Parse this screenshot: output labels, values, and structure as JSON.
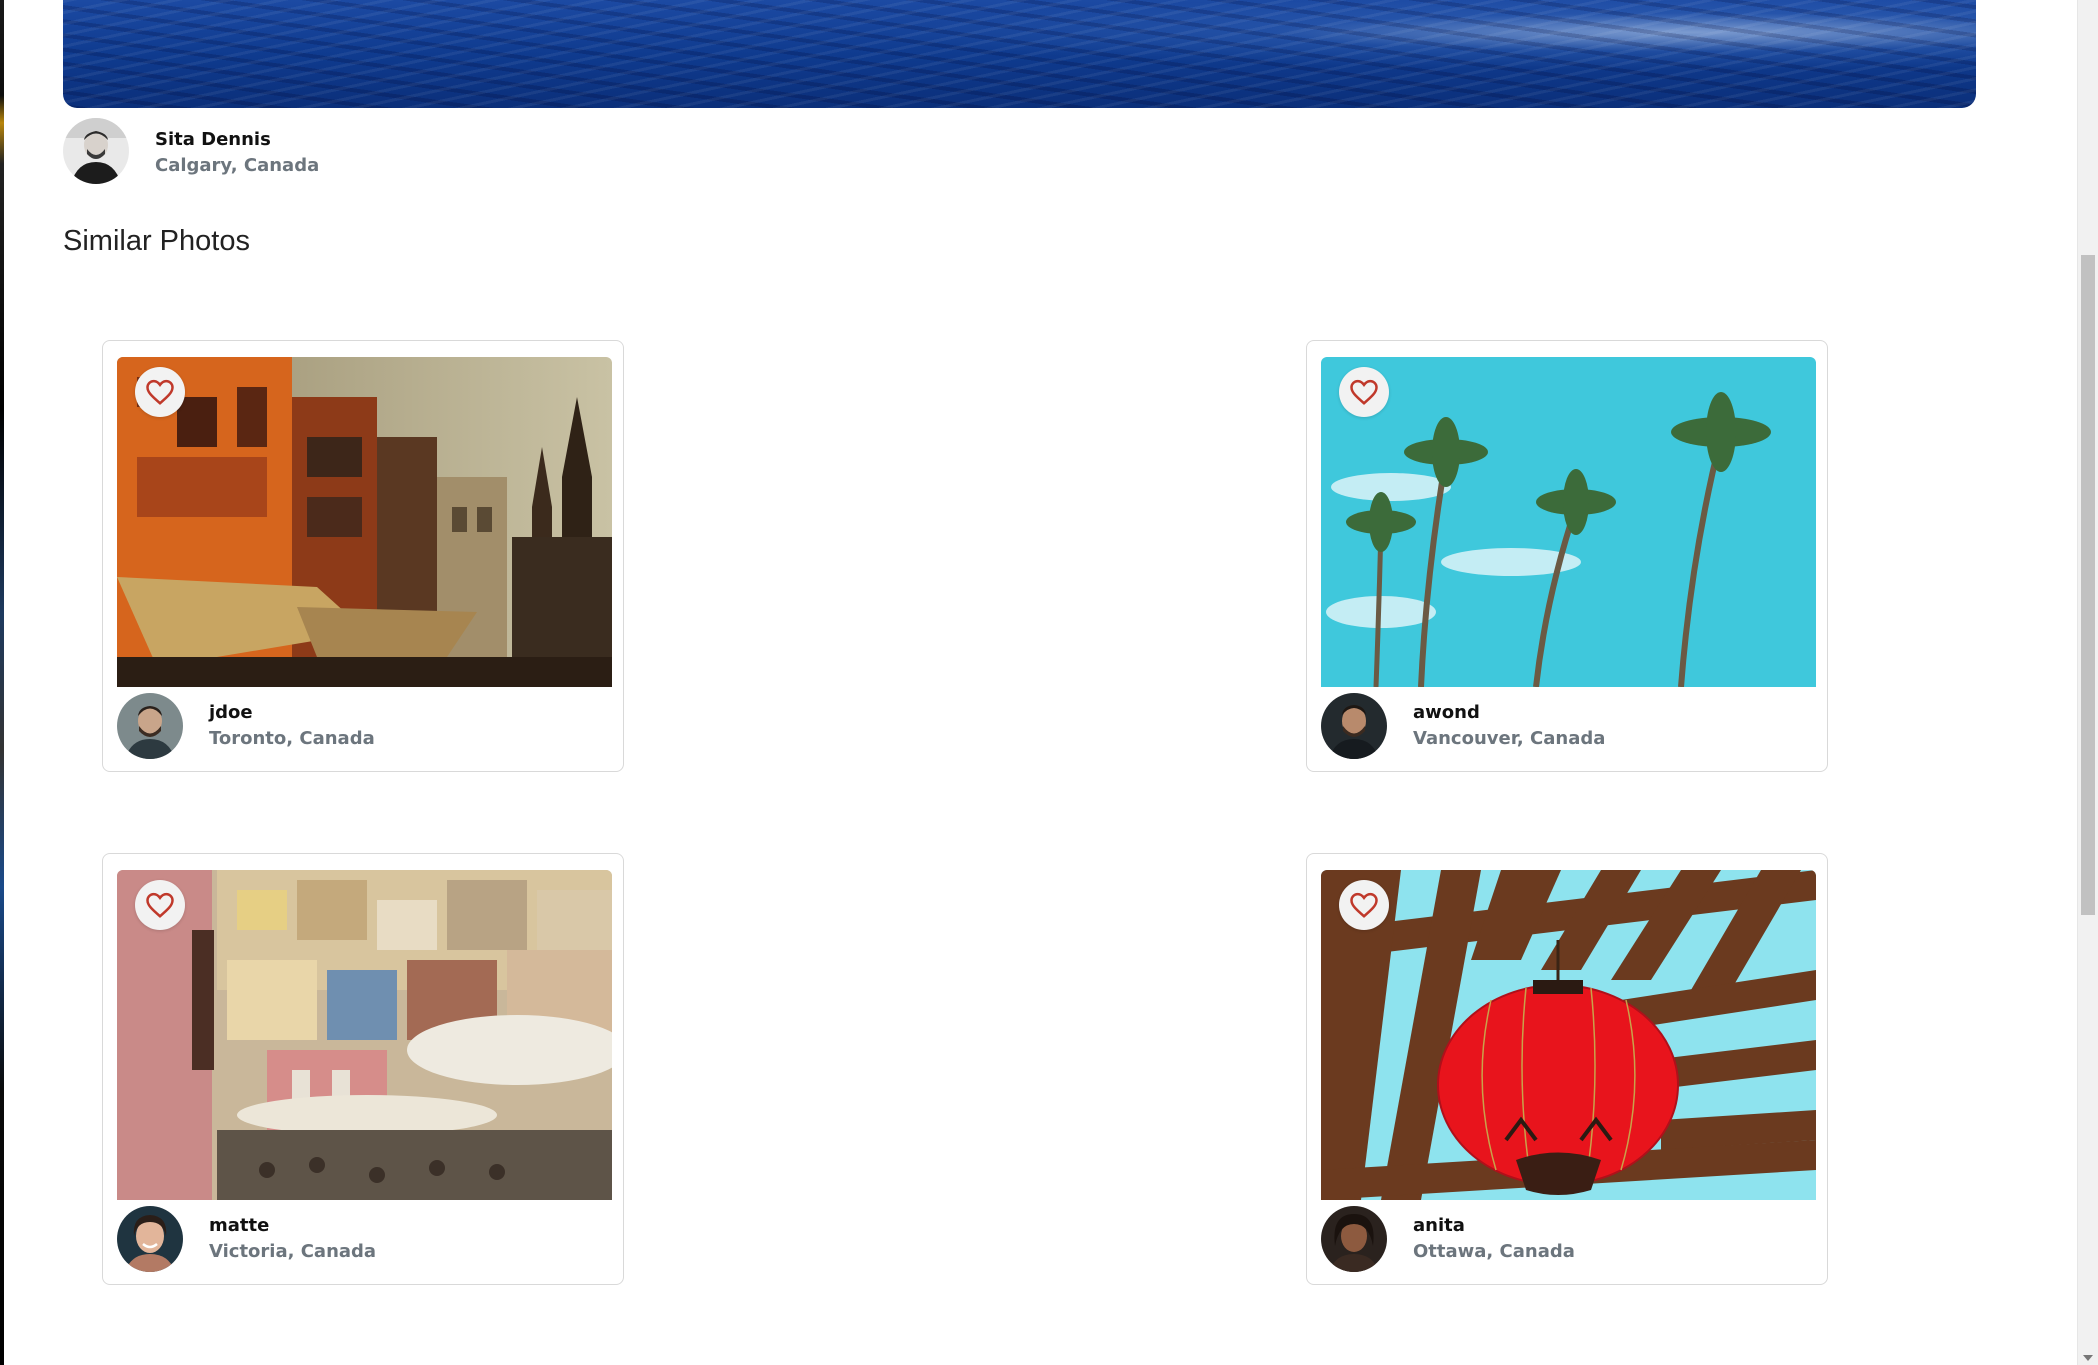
{
  "main_photo": {
    "author": {
      "name": "Sita Dennis",
      "location": "Calgary, Canada",
      "avatar_icon": "avatar-photo"
    }
  },
  "section": {
    "title": "Similar Photos"
  },
  "cards": [
    {
      "photo": "orange-buildings-temple",
      "favorite_icon": "heart-icon",
      "author": {
        "name": "jdoe",
        "location": "Toronto, Canada"
      }
    },
    {
      "photo": "palm-trees-sky",
      "favorite_icon": "heart-icon",
      "author": {
        "name": "awond",
        "location": "Vancouver, Canada"
      }
    },
    {
      "photo": "colorful-hillside-town",
      "favorite_icon": "heart-icon",
      "author": {
        "name": "matte",
        "location": "Victoria, Canada"
      }
    },
    {
      "photo": "red-lantern-pergola",
      "favorite_icon": "heart-icon",
      "author": {
        "name": "anita",
        "location": "Ottawa, Canada"
      }
    }
  ],
  "colors": {
    "heart": "#c0392b",
    "muted_text": "#6c757d",
    "card_border": "#d9d9d9"
  }
}
